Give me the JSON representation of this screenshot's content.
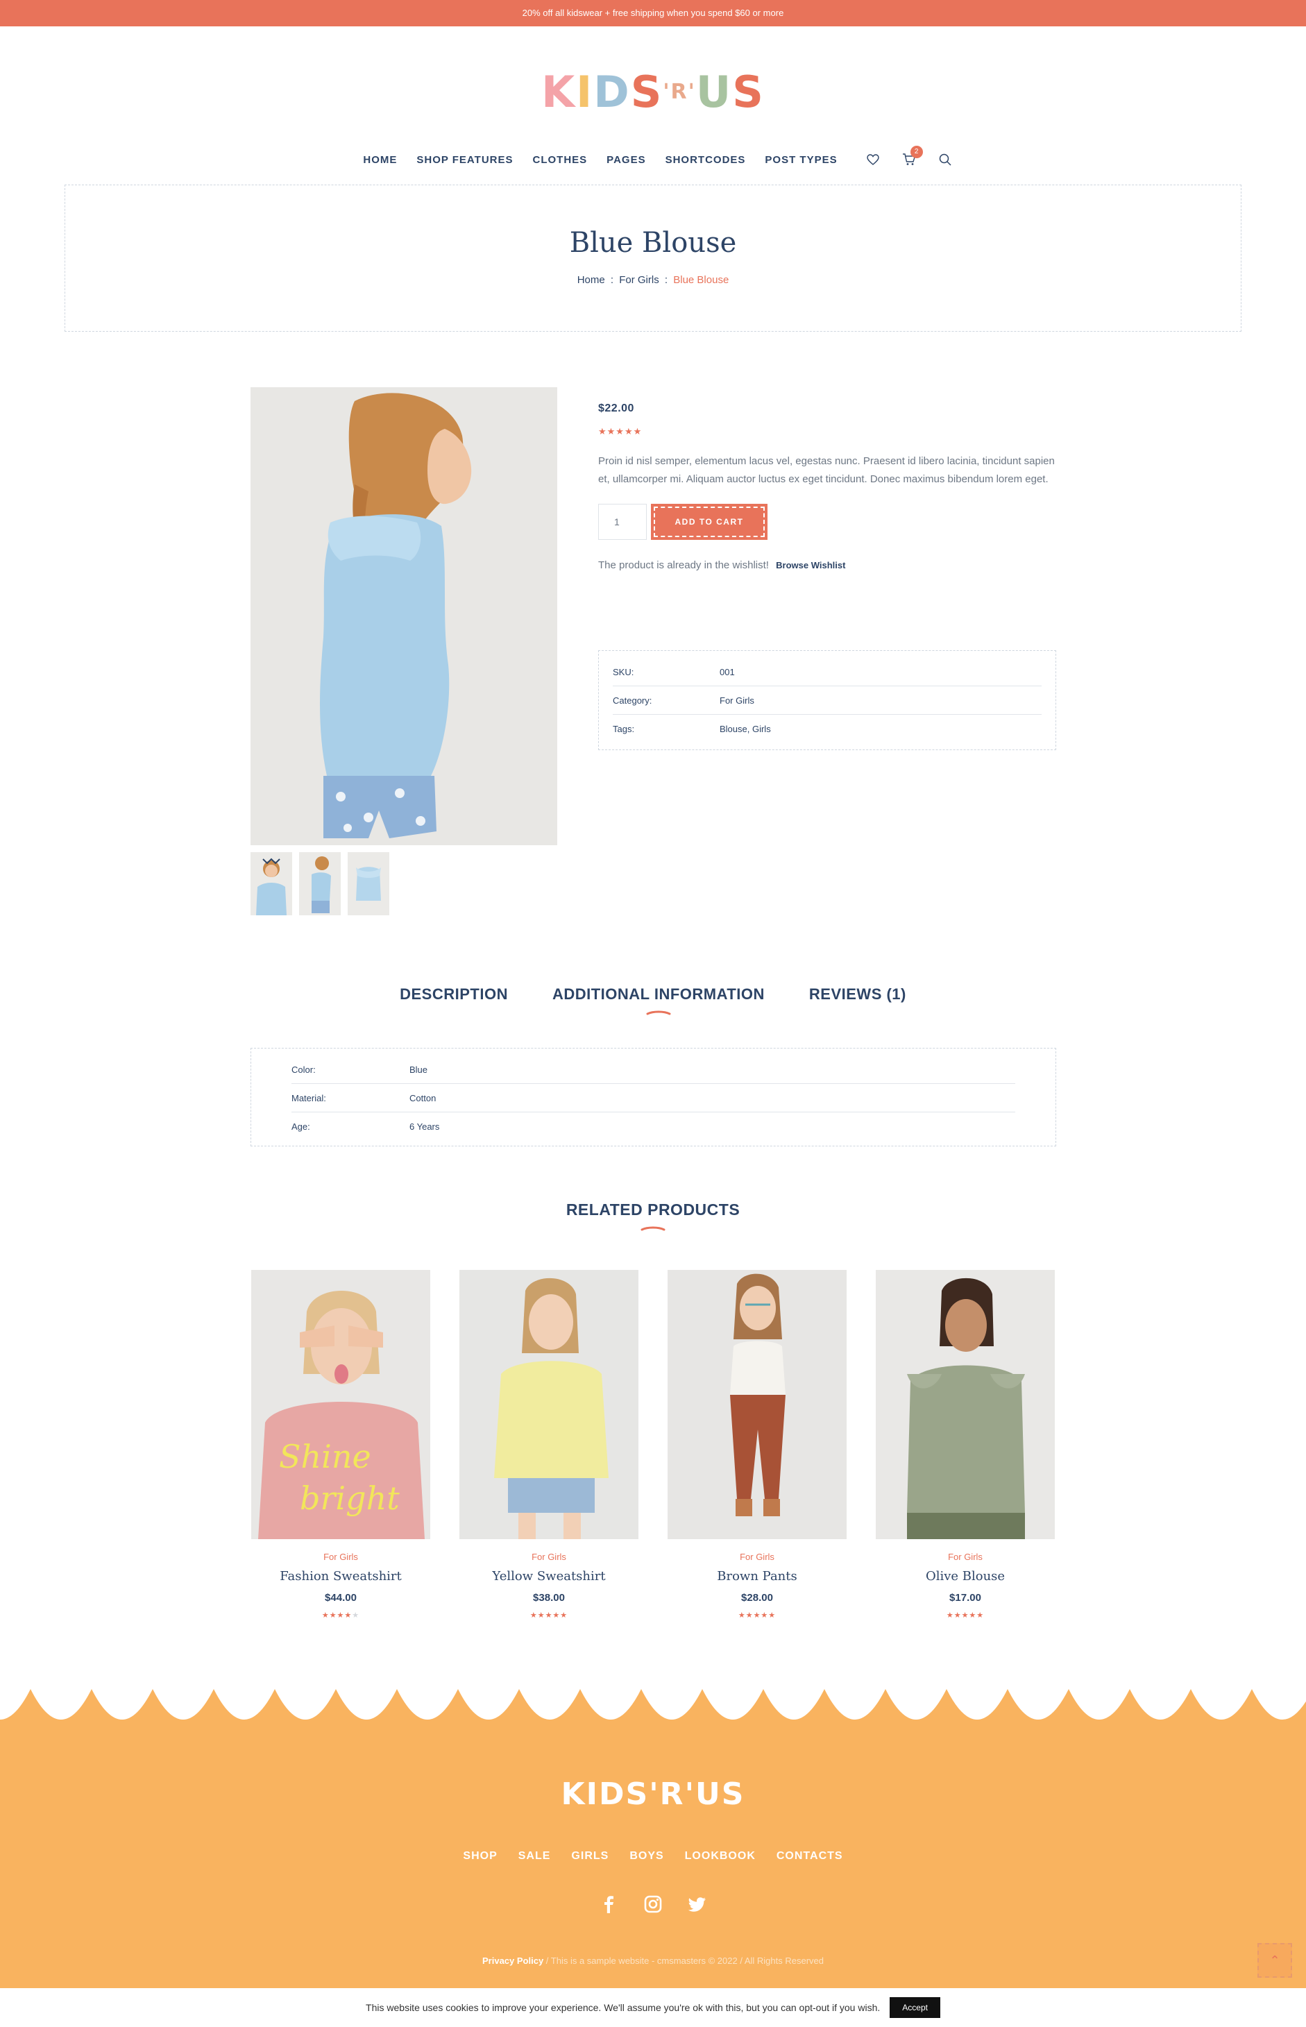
{
  "topbar": {
    "text": "20% off all kidswear + free shipping when you spend $60 or more"
  },
  "logo": {
    "letters": [
      "K",
      "I",
      "D",
      "S",
      "'R'",
      "U",
      "S"
    ]
  },
  "nav": {
    "items": [
      "HOME",
      "SHOP FEATURES",
      "CLOTHES",
      "PAGES",
      "SHORTCODES",
      "POST TYPES"
    ],
    "cart_count": "2"
  },
  "page": {
    "title": "Blue Blouse",
    "breadcrumb": {
      "home": "Home",
      "sep": ":",
      "category": "For Girls",
      "current": "Blue Blouse"
    }
  },
  "product": {
    "price": "$22.00",
    "rating_stars": "★★★★★",
    "description": "Proin id nisl semper, elementum lacus vel, egestas nunc. Praesent id libero lacinia, tincidunt sapien et, ullamcorper mi. Aliquam auctor luctus ex eget tincidunt. Donec maximus bibendum lorem eget.",
    "quantity": "1",
    "add_to_cart": "ADD TO CART",
    "wishlist_text": "The product is already in the wishlist!",
    "wishlist_link": "Browse Wishlist",
    "meta": [
      {
        "k": "SKU:",
        "v": "001"
      },
      {
        "k": "Category:",
        "v": "For Girls"
      },
      {
        "k": "Tags:",
        "v": "Blouse, Girls"
      }
    ]
  },
  "tabs": [
    "DESCRIPTION",
    "ADDITIONAL INFORMATION",
    "REVIEWS (1)"
  ],
  "additional_info": [
    {
      "k": "Color:",
      "v": "Blue"
    },
    {
      "k": "Material:",
      "v": "Cotton"
    },
    {
      "k": "Age:",
      "v": "6 Years"
    }
  ],
  "related": {
    "title": "RELATED PRODUCTS",
    "items": [
      {
        "cat": "For Girls",
        "name": "Fashion Sweatshirt",
        "price": "$44.00",
        "stars_on": "★★★★",
        "stars_off": "★"
      },
      {
        "cat": "For Girls",
        "name": "Yellow Sweatshirt",
        "price": "$38.00",
        "stars_on": "★★★★★",
        "stars_off": ""
      },
      {
        "cat": "For Girls",
        "name": "Brown Pants",
        "price": "$28.00",
        "stars_on": "★★★★★",
        "stars_off": ""
      },
      {
        "cat": "For Girls",
        "name": "Olive Blouse",
        "price": "$17.00",
        "stars_on": "★★★★★",
        "stars_off": ""
      }
    ]
  },
  "footer": {
    "logo": "KIDS'R'US",
    "links": [
      "SHOP",
      "SALE",
      "GIRLS",
      "BOYS",
      "LOOKBOOK",
      "CONTACTS"
    ],
    "privacy": "Privacy Policy",
    "copyright": " / This is a sample website - cmsmasters © 2022 / All Rights Reserved"
  },
  "cookie": {
    "text": "This website uses cookies to improve your experience. We'll assume you're ok with this, but you can opt-out if you wish.",
    "accept": "Accept"
  },
  "colors": {
    "accent": "#e8735a",
    "navy": "#2d4466",
    "footer": "#f9b35f"
  }
}
